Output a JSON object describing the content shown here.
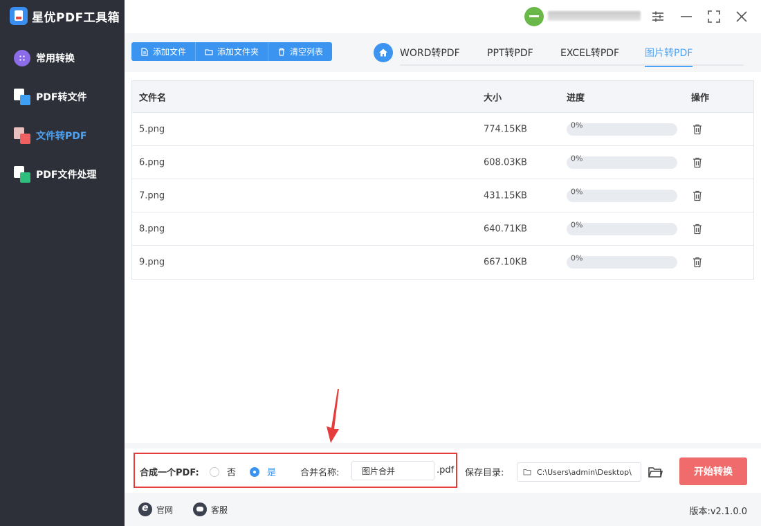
{
  "app": {
    "title": "星优PDF工具箱"
  },
  "sidebar": {
    "items": [
      {
        "label": "常用转换",
        "icon": "grid-icon",
        "active": false
      },
      {
        "label": "PDF转文件",
        "icon": "pdf-to-file-icon",
        "active": false
      },
      {
        "label": "文件转PDF",
        "icon": "file-to-pdf-icon",
        "active": true
      },
      {
        "label": "PDF文件处理",
        "icon": "pdf-process-icon",
        "active": false
      }
    ]
  },
  "toolbar": {
    "add_file": "添加文件",
    "add_folder": "添加文件夹",
    "clear_list": "清空列表"
  },
  "tabs": [
    {
      "label": "WORD转PDF",
      "active": false
    },
    {
      "label": "PPT转PDF",
      "active": false
    },
    {
      "label": "EXCEL转PDF",
      "active": false
    },
    {
      "label": "图片转PDF",
      "active": true
    }
  ],
  "table": {
    "headers": {
      "name": "文件名",
      "size": "大小",
      "progress": "进度",
      "action": "操作"
    },
    "rows": [
      {
        "name": "5.png",
        "size": "774.15KB",
        "progress": "0%",
        "progress_value": 0
      },
      {
        "name": "6.png",
        "size": "608.03KB",
        "progress": "0%",
        "progress_value": 0
      },
      {
        "name": "7.png",
        "size": "431.15KB",
        "progress": "0%",
        "progress_value": 0
      },
      {
        "name": "8.png",
        "size": "640.71KB",
        "progress": "0%",
        "progress_value": 0
      },
      {
        "name": "9.png",
        "size": "667.10KB",
        "progress": "0%",
        "progress_value": 0
      }
    ]
  },
  "options": {
    "merge_label": "合成一个PDF:",
    "no_label": "否",
    "yes_label": "是",
    "merge_selected": "是",
    "name_label": "合并名称:",
    "name_value": "图片合并",
    "ext": ".pdf",
    "save_label": "保存目录:",
    "save_path": "C:\\Users\\admin\\Desktop\\",
    "start_label": "开始转换"
  },
  "footer": {
    "website": "官网",
    "service": "客服",
    "version": "版本:v2.1.0.0"
  },
  "colors": {
    "accent": "#3b95f0",
    "sidebar_bg": "#2d3039",
    "start_button": "#f06b6b",
    "highlight_box": "#e53c3c"
  }
}
